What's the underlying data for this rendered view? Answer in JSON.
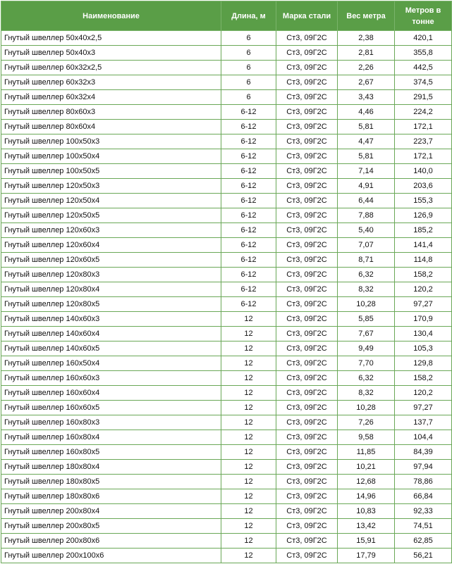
{
  "table": {
    "headers": [
      "Наименование",
      "Длина, м",
      "Марка стали",
      "Вес метра",
      "Метров в тонне"
    ],
    "rows": [
      [
        "Гнутый швеллер 50х40х2,5",
        "6",
        "Ст3, 09Г2С",
        "2,38",
        "420,1"
      ],
      [
        "Гнутый швеллер 50х40х3",
        "6",
        "Ст3, 09Г2С",
        "2,81",
        "355,8"
      ],
      [
        "Гнутый швеллер 60х32х2,5",
        "6",
        "Ст3, 09Г2С",
        "2,26",
        "442,5"
      ],
      [
        "Гнутый швеллер 60х32х3",
        "6",
        "Ст3, 09Г2С",
        "2,67",
        "374,5"
      ],
      [
        "Гнутый швеллер 60х32х4",
        "6",
        "Ст3, 09Г2С",
        "3,43",
        "291,5"
      ],
      [
        "Гнутый швеллер 80х60х3",
        "6-12",
        "Ст3, 09Г2С",
        "4,46",
        "224,2"
      ],
      [
        "Гнутый швеллер 80х60х4",
        "6-12",
        "Ст3, 09Г2С",
        "5,81",
        "172,1"
      ],
      [
        "Гнутый швеллер 100х50х3",
        "6-12",
        "Ст3, 09Г2С",
        "4,47",
        "223,7"
      ],
      [
        "Гнутый швеллер 100х50х4",
        "6-12",
        "Ст3, 09Г2С",
        "5,81",
        "172,1"
      ],
      [
        "Гнутый швеллер 100х50х5",
        "6-12",
        "Ст3, 09Г2С",
        "7,14",
        "140,0"
      ],
      [
        "Гнутый швеллер 120х50х3",
        "6-12",
        "Ст3, 09Г2С",
        "4,91",
        "203,6"
      ],
      [
        "Гнутый швеллер 120х50х4",
        "6-12",
        "Ст3, 09Г2С",
        "6,44",
        "155,3"
      ],
      [
        "Гнутый швеллер 120х50х5",
        "6-12",
        "Ст3, 09Г2С",
        "7,88",
        "126,9"
      ],
      [
        "Гнутый швеллер 120х60х3",
        "6-12",
        "Ст3, 09Г2С",
        "5,40",
        "185,2"
      ],
      [
        "Гнутый швеллер 120х60х4",
        "6-12",
        "Ст3, 09Г2С",
        "7,07",
        "141,4"
      ],
      [
        "Гнутый швеллер 120х60х5",
        "6-12",
        "Ст3, 09Г2С",
        "8,71",
        "114,8"
      ],
      [
        "Гнутый швеллер 120х80х3",
        "6-12",
        "Ст3, 09Г2С",
        "6,32",
        "158,2"
      ],
      [
        "Гнутый швеллер 120х80х4",
        "6-12",
        "Ст3, 09Г2С",
        "8,32",
        "120,2"
      ],
      [
        "Гнутый швеллер 120х80х5",
        "6-12",
        "Ст3, 09Г2С",
        "10,28",
        "97,27"
      ],
      [
        "Гнутый швеллер 140х60х3",
        "12",
        "Ст3, 09Г2С",
        "5,85",
        "170,9"
      ],
      [
        "Гнутый швеллер 140х60х4",
        "12",
        "Ст3, 09Г2С",
        "7,67",
        "130,4"
      ],
      [
        "Гнутый швеллер 140х60х5",
        "12",
        "Ст3, 09Г2С",
        "9,49",
        "105,3"
      ],
      [
        "Гнутый швеллер 160х50х4",
        "12",
        "Ст3, 09Г2С",
        "7,70",
        "129,8"
      ],
      [
        "Гнутый швеллер 160х60х3",
        "12",
        "Ст3, 09Г2С",
        "6,32",
        "158,2"
      ],
      [
        "Гнутый швеллер 160х60х4",
        "12",
        "Ст3, 09Г2С",
        "8,32",
        "120,2"
      ],
      [
        "Гнутый швеллер 160х60х5",
        "12",
        "Ст3, 09Г2С",
        "10,28",
        "97,27"
      ],
      [
        "Гнутый швеллер 160х80х3",
        "12",
        "Ст3, 09Г2С",
        "7,26",
        "137,7"
      ],
      [
        "Гнутый швеллер 160х80х4",
        "12",
        "Ст3, 09Г2С",
        "9,58",
        "104,4"
      ],
      [
        "Гнутый швеллер 160х80х5",
        "12",
        "Ст3, 09Г2С",
        "11,85",
        "84,39"
      ],
      [
        "Гнутый швеллер 180х80х4",
        "12",
        "Ст3, 09Г2С",
        "10,21",
        "97,94"
      ],
      [
        "Гнутый швеллер 180х80х5",
        "12",
        "Ст3, 09Г2С",
        "12,68",
        "78,86"
      ],
      [
        "Гнутый швеллер 180х80х6",
        "12",
        "Ст3, 09Г2С",
        "14,96",
        "66,84"
      ],
      [
        "Гнутый швеллер 200х80х4",
        "12",
        "Ст3, 09Г2С",
        "10,83",
        "92,33"
      ],
      [
        "Гнутый швеллер 200х80х5",
        "12",
        "Ст3, 09Г2С",
        "13,42",
        "74,51"
      ],
      [
        "Гнутый швеллер 200х80х6",
        "12",
        "Ст3, 09Г2С",
        "15,91",
        "62,85"
      ],
      [
        "Гнутый швеллер 200х100х6",
        "12",
        "Ст3, 09Г2С",
        "17,79",
        "56,21"
      ]
    ]
  }
}
